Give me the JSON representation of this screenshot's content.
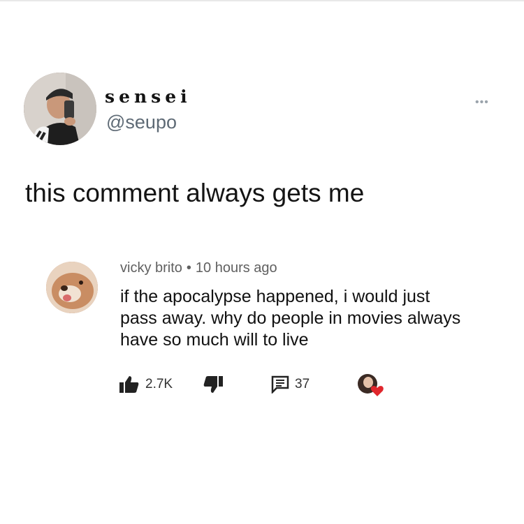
{
  "tweet": {
    "display_name": "sensei",
    "handle": "@seupo",
    "text": "this comment always gets me",
    "more_label": "•••"
  },
  "comment": {
    "author": "vicky brito",
    "separator": "•",
    "time": "10 hours ago",
    "lines": [
      "if the apocalypse happened, i would just",
      "pass away. why do people in movies always",
      "have so much will to live"
    ],
    "likes": "2.7K",
    "replies": "37",
    "heart_color": "#e0262c"
  }
}
